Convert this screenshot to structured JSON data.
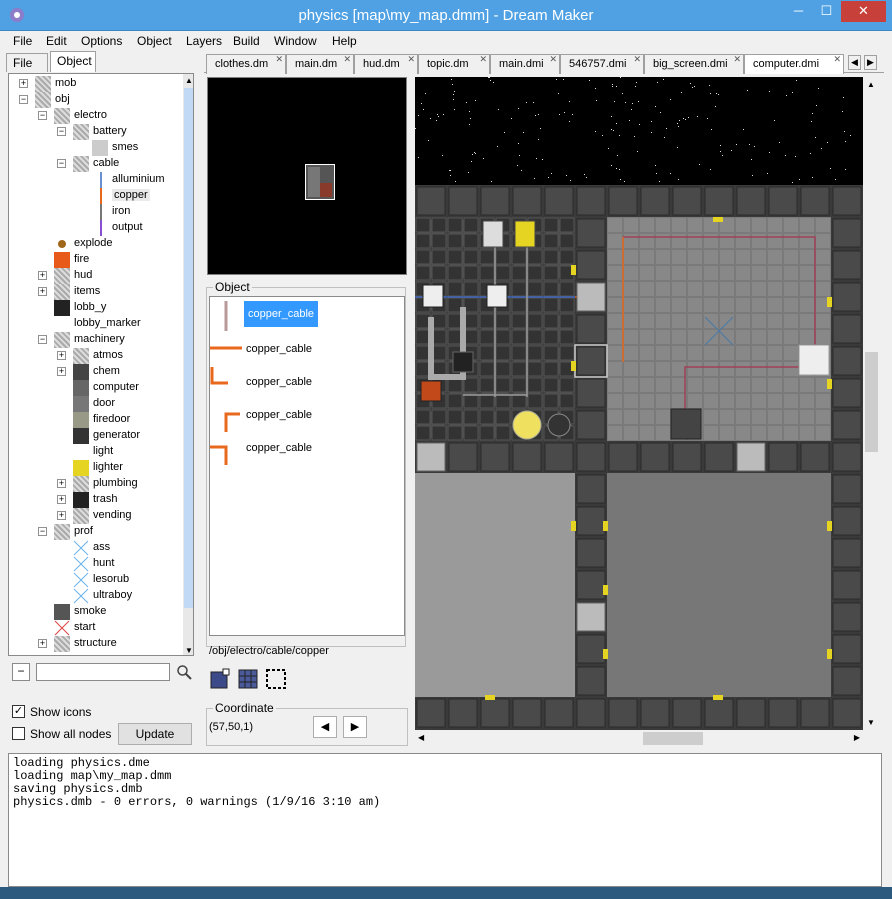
{
  "window": {
    "title": "physics [map\\my_map.dmm] - Dream Maker",
    "min": "─",
    "max": "☐",
    "close": "✕"
  },
  "menu": [
    "File",
    "Edit",
    "Options",
    "Object",
    "Layers",
    "Build",
    "Window",
    "Help"
  ],
  "left_tabs": [
    "File",
    "Object"
  ],
  "tree": [
    {
      "label": "mob",
      "depth": 0,
      "expander": "+"
    },
    {
      "label": "obj",
      "depth": 0,
      "expander": "−"
    },
    {
      "label": "electro",
      "depth": 1,
      "expander": "−"
    },
    {
      "label": "battery",
      "depth": 2,
      "expander": "−"
    },
    {
      "label": "smes",
      "depth": 3,
      "expander": ""
    },
    {
      "label": "cable",
      "depth": 2,
      "expander": "−"
    },
    {
      "label": "alluminium",
      "depth": 3,
      "expander": ""
    },
    {
      "label": "copper",
      "depth": 3,
      "expander": "",
      "selected": true
    },
    {
      "label": "iron",
      "depth": 3,
      "expander": ""
    },
    {
      "label": "output",
      "depth": 3,
      "expander": ""
    },
    {
      "label": "explode",
      "depth": 1,
      "expander": ""
    },
    {
      "label": "fire",
      "depth": 1,
      "expander": ""
    },
    {
      "label": "hud",
      "depth": 1,
      "expander": "+"
    },
    {
      "label": "items",
      "depth": 1,
      "expander": "+"
    },
    {
      "label": "lobb_y",
      "depth": 1,
      "expander": ""
    },
    {
      "label": "lobby_marker",
      "depth": 1,
      "expander": ""
    },
    {
      "label": "machinery",
      "depth": 1,
      "expander": "−"
    },
    {
      "label": "atmos",
      "depth": 2,
      "expander": "+"
    },
    {
      "label": "chem",
      "depth": 2,
      "expander": "+"
    },
    {
      "label": "computer",
      "depth": 2,
      "expander": ""
    },
    {
      "label": "door",
      "depth": 2,
      "expander": ""
    },
    {
      "label": "firedoor",
      "depth": 2,
      "expander": ""
    },
    {
      "label": "generator",
      "depth": 2,
      "expander": ""
    },
    {
      "label": "light",
      "depth": 2,
      "expander": ""
    },
    {
      "label": "lighter",
      "depth": 2,
      "expander": ""
    },
    {
      "label": "plumbing",
      "depth": 2,
      "expander": "+"
    },
    {
      "label": "trash",
      "depth": 2,
      "expander": "+"
    },
    {
      "label": "vending",
      "depth": 2,
      "expander": "+"
    },
    {
      "label": "prof",
      "depth": 1,
      "expander": "−"
    },
    {
      "label": "ass",
      "depth": 2,
      "expander": ""
    },
    {
      "label": "hunt",
      "depth": 2,
      "expander": ""
    },
    {
      "label": "lesorub",
      "depth": 2,
      "expander": ""
    },
    {
      "label": "ultraboy",
      "depth": 2,
      "expander": ""
    },
    {
      "label": "smoke",
      "depth": 1,
      "expander": ""
    },
    {
      "label": "start",
      "depth": 1,
      "expander": ""
    },
    {
      "label": "structure",
      "depth": 1,
      "expander": "+"
    }
  ],
  "search": {
    "value": "",
    "placeholder": ""
  },
  "show_icons": {
    "label": "Show icons",
    "checked": "✓"
  },
  "show_all_nodes": {
    "label": "Show all nodes",
    "checked": ""
  },
  "update_label": "Update",
  "file_tabs": [
    "clothes.dm",
    "main.dm",
    "hud.dm",
    "topic.dm",
    "main.dmi",
    "546757.dmi",
    "big_screen.dmi",
    "computer.dmi"
  ],
  "object_panel": {
    "legend": "Object",
    "items": [
      "copper_cable",
      "copper_cable",
      "copper_cable",
      "copper_cable",
      "copper_cable"
    ],
    "path": "/obj/electro/cable/copper"
  },
  "coordinate": {
    "legend": "Coordinate",
    "value": "(57,50,1)",
    "prev": "◀",
    "next": "▶"
  },
  "console": [
    "loading physics.dme",
    "loading map\\my_map.dmm",
    "saving physics.dmb",
    "physics.dmb - 0 errors, 0 warnings (1/9/16 3:10 am)"
  ],
  "colors": {
    "titlebar": "#4fa1e3",
    "close": "#c7413a",
    "cable": "#e8681e",
    "selection": "#3399ff"
  }
}
